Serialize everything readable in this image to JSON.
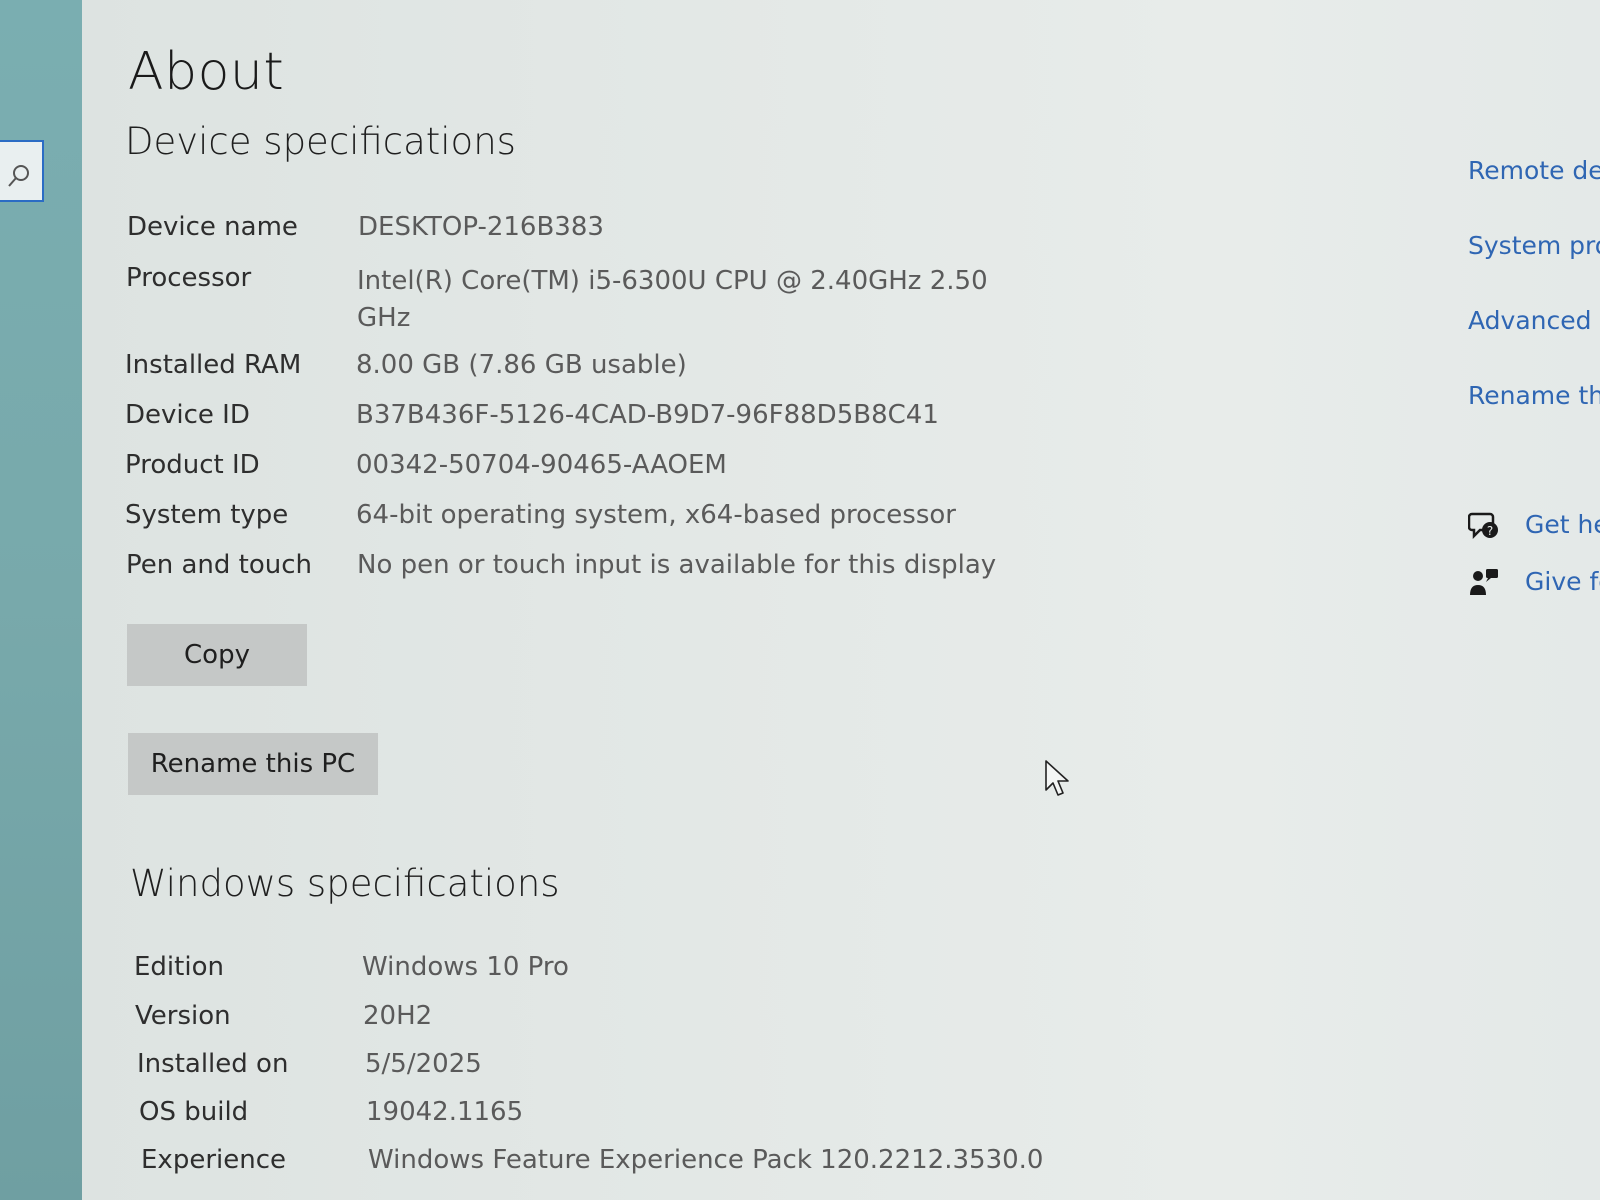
{
  "nav": {
    "search_icon": "search-icon"
  },
  "page": {
    "title": "About"
  },
  "device_specs": {
    "heading": "Device specifications",
    "rows": [
      {
        "label": "Device name",
        "value": "DESKTOP-216B383"
      },
      {
        "label": "Processor",
        "value": "Intel(R) Core(TM) i5-6300U CPU @ 2.40GHz   2.50 GHz"
      },
      {
        "label": "Installed RAM",
        "value": "8.00 GB (7.86 GB usable)"
      },
      {
        "label": "Device ID",
        "value": "B37B436F-5126-4CAD-B9D7-96F88D5B8C41"
      },
      {
        "label": "Product ID",
        "value": "00342-50704-90465-AAOEM"
      },
      {
        "label": "System type",
        "value": "64-bit operating system, x64-based processor"
      },
      {
        "label": "Pen and touch",
        "value": "No pen or touch input is available for this display"
      }
    ],
    "copy_button": "Copy",
    "rename_button": "Rename this PC"
  },
  "windows_specs": {
    "heading": "Windows specifications",
    "rows": [
      {
        "label": "Edition",
        "value": "Windows 10 Pro"
      },
      {
        "label": "Version",
        "value": "20H2"
      },
      {
        "label": "Installed on",
        "value": "5/5/2025"
      },
      {
        "label": "OS build",
        "value": "19042.1165"
      },
      {
        "label": "Experience",
        "value": "Windows Feature Experience Pack 120.2212.3530.0"
      }
    ]
  },
  "related": {
    "links": [
      "Remote des",
      "System prot",
      "Advanced s",
      "Rename this"
    ],
    "help_link": "Get hel",
    "feedback_link": "Give fe"
  },
  "colors": {
    "link": "#2f66b3",
    "sidebar": "#78a9ab",
    "button": "#c5c8c7"
  }
}
